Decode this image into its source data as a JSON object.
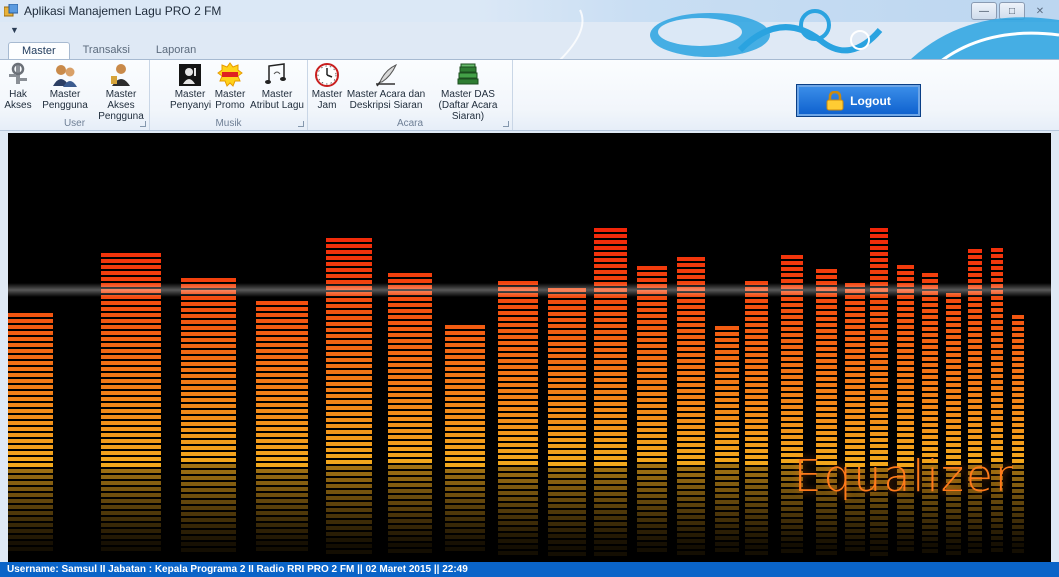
{
  "window": {
    "title": "Aplikasi Manajemen Lagu PRO 2 FM"
  },
  "tabs": [
    {
      "label": "Master",
      "active": true
    },
    {
      "label": "Transaksi",
      "active": false
    },
    {
      "label": "Laporan",
      "active": false
    }
  ],
  "ribbon": {
    "groups": [
      {
        "label": "User",
        "buttons": [
          {
            "label": "Hak Akses",
            "icon": "keys-icon"
          },
          {
            "label": "Master Pengguna",
            "icon": "users-icon"
          },
          {
            "label": "Master Akses Pengguna",
            "icon": "user-key-icon"
          }
        ]
      },
      {
        "label": "Musik",
        "buttons": [
          {
            "label": "Master Penyanyi",
            "icon": "singer-icon"
          },
          {
            "label": "Master Promo",
            "icon": "promo-icon"
          },
          {
            "label": "Master Atribut Lagu",
            "icon": "music-notes-icon"
          }
        ]
      },
      {
        "label": "Acara",
        "buttons": [
          {
            "label": "Master Jam",
            "icon": "clock-icon"
          },
          {
            "label": "Master Acara dan Deskripsi Siaran",
            "icon": "quill-icon"
          },
          {
            "label": "Master DAS (Daftar Acara Siaran)",
            "icon": "books-icon"
          }
        ]
      }
    ]
  },
  "logout": {
    "label": "Logout",
    "icon": "lock-icon"
  },
  "main_image": {
    "caption": "Equalizer"
  },
  "status": {
    "text": "Username:  Samsul  II  Jabatan :  Kepala Programa 2  II  Radio RRI PRO 2 FM  ||  02 Maret 2015  ||  22:49"
  },
  "colors": {
    "accent": "#0a64c8",
    "equalizer_orange": "#ff6a00"
  }
}
